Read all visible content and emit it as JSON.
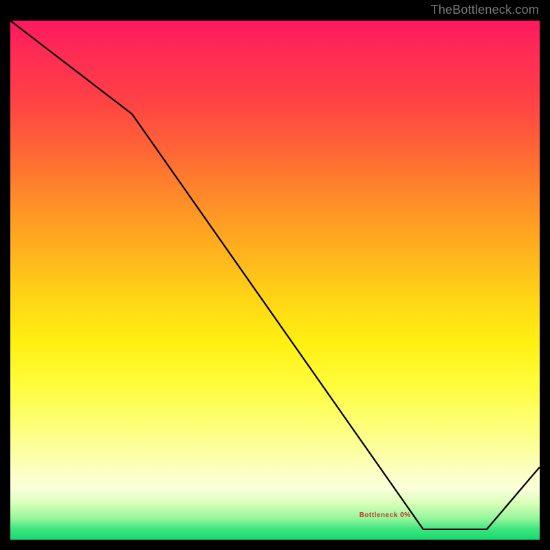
{
  "watermark": "TheBottleneck.com",
  "bottom_label": "Bottleneck 0%",
  "chart_data": {
    "type": "line",
    "title": "",
    "xlabel": "",
    "ylabel": "",
    "xlim": [
      0,
      1
    ],
    "ylim": [
      0,
      1
    ],
    "x": [
      0.0,
      0.23,
      0.78,
      0.9,
      1.0
    ],
    "values": [
      1.0,
      0.82,
      0.02,
      0.02,
      0.14
    ],
    "line_color": "#000000",
    "gradient_stops": [
      {
        "pos": 0.0,
        "color": "#ff1860"
      },
      {
        "pos": 0.3,
        "color": "#ff7a2e"
      },
      {
        "pos": 0.62,
        "color": "#fff012"
      },
      {
        "pos": 0.9,
        "color": "#f8ffd8"
      },
      {
        "pos": 1.0,
        "color": "#14d96e"
      }
    ],
    "note": "Axes have no visible tick labels in the source image; x/y are normalized 0..1. Line values estimated from pixel positions."
  }
}
